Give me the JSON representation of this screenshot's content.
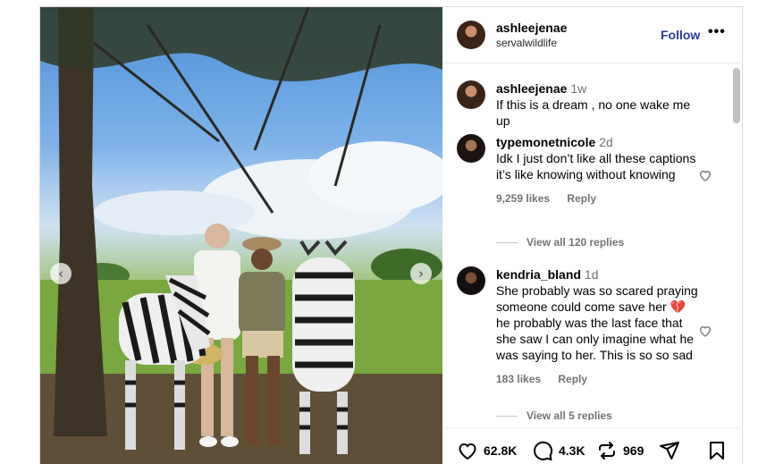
{
  "header": {
    "username": "ashleejenae",
    "location": "servalwildlife",
    "follow_label": "Follow",
    "more_label": "•••"
  },
  "media": {
    "prev_label": "‹",
    "next_label": "›"
  },
  "caption": {
    "username": "ashleejenae",
    "time": "1w",
    "text": "If this is a dream , no one wake me up"
  },
  "comments": [
    {
      "username": "typemonetnicole",
      "time": "2d",
      "text": "Idk I just don’t like all these captions it’s like knowing without knowing",
      "likes": "9,259 likes",
      "reply_label": "Reply",
      "view_replies": "View all 120 replies"
    },
    {
      "username": "kendria_bland",
      "time": "1d",
      "text": "She probably was so scared praying someone could come save her 💔 he probably was the last face that she saw I can only imagine what he was saying to her. This is so so sad",
      "likes": "183 likes",
      "reply_label": "Reply",
      "view_replies": "View all 5 replies"
    }
  ],
  "actions": {
    "likes": "62.8K",
    "comments": "4.3K",
    "reposts": "969"
  },
  "colors": {
    "follow": "#2a3c9e",
    "muted": "#737373",
    "border": "#dbdbdb"
  }
}
